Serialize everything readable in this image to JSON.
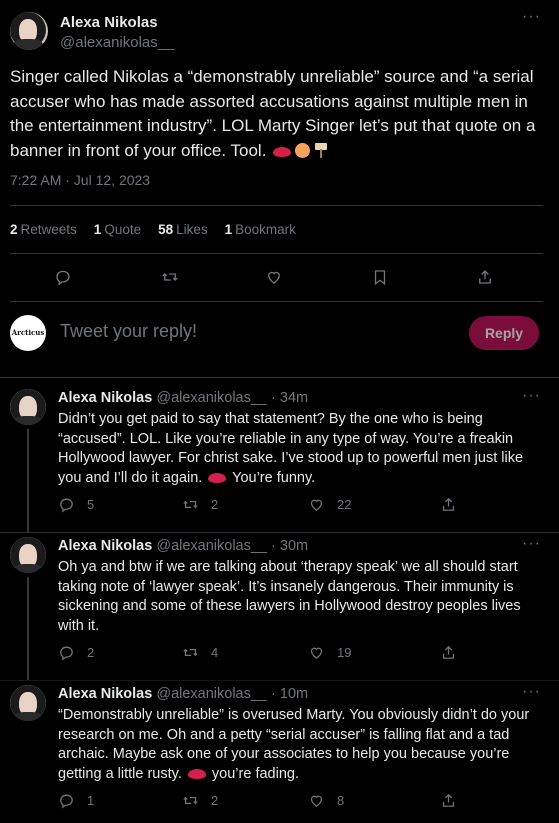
{
  "tweet": {
    "author_name": "Alexa Nikolas",
    "author_handle": "@alexanikolas__",
    "text": "Singer called Nikolas a “demonstrably unreliable” source and “a serial accuser who has made assorted accusations against multiple men in the entertainment industry”. LOL Marty Singer let’s put that quote on a banner in front of your office. Tool.",
    "timestamp": "7:22 AM · Jul 12, 2023",
    "stats": {
      "retweets_count": "2",
      "retweets_label": "Retweets",
      "quotes_count": "1",
      "quotes_label": "Quote",
      "likes_count": "58",
      "likes_label": "Likes",
      "bookmarks_count": "1",
      "bookmarks_label": "Bookmark"
    }
  },
  "composer": {
    "placeholder": "Tweet your reply!",
    "reply_label": "Reply",
    "avatar_text": "Arcticus"
  },
  "replies": [
    {
      "name": "Alexa Nikolas",
      "handle": "@alexanikolas__",
      "time": "· 34m",
      "text_a": "Didn’t you get paid to say that statement? By the one who is being “accused”. LOL. Like you’re reliable in any type of way. You’re a freakin Hollywood lawyer. For christ sake. I’ve stood up to powerful men just like you and I’ll do it again.",
      "text_b": "You’re funny.",
      "replies": "5",
      "retweets": "2",
      "likes": "22"
    },
    {
      "name": "Alexa Nikolas",
      "handle": "@alexanikolas__",
      "time": "· 30m",
      "text_a": "Oh ya and btw if we are talking about ‘therapy speak’ we all should start taking note of ‘lawyer speak’. It’s insanely dangerous. Their immunity is sickening and some of these lawyers in Hollywood destroy peoples lives with it.",
      "text_b": "",
      "replies": "2",
      "retweets": "4",
      "likes": "19"
    },
    {
      "name": "Alexa Nikolas",
      "handle": "@alexanikolas__",
      "time": "· 10m",
      "text_a": "“Demonstrably unreliable” is overused Marty. You obviously didn’t do your research on me. Oh and a petty “serial accuser” is falling flat and a tad archaic. Maybe ask one of your associates to help you because you’re getting a little rusty.",
      "text_b": "you’re fading.",
      "replies": "1",
      "retweets": "2",
      "likes": "8"
    }
  ],
  "icons": {
    "more": "more-icon",
    "reply": "reply-icon",
    "retweet": "retweet-icon",
    "like": "heart-icon",
    "bookmark": "bookmark-icon",
    "share": "share-icon"
  },
  "colors": {
    "background": "#000000",
    "text": "#e7e9ea",
    "muted": "#71767b",
    "divider": "#2f3336",
    "reply_button": "#7b0d3a"
  }
}
